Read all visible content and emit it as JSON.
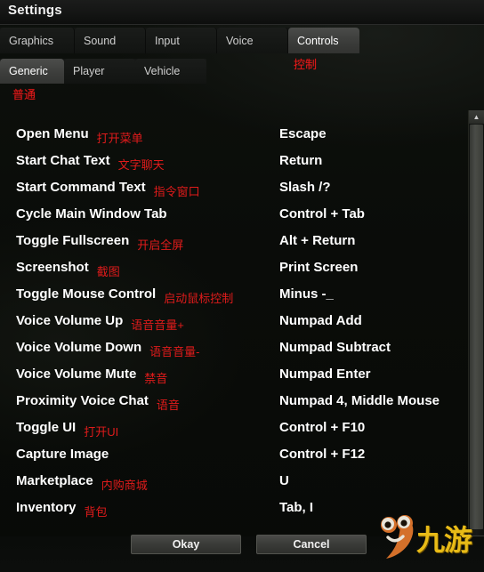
{
  "window": {
    "title": "Settings"
  },
  "tabs": [
    {
      "label": "Graphics",
      "active": false
    },
    {
      "label": "Sound",
      "active": false
    },
    {
      "label": "Input",
      "active": false
    },
    {
      "label": "Voice",
      "active": false
    },
    {
      "label": "Controls",
      "active": true,
      "annotation": "控制"
    }
  ],
  "subtabs": [
    {
      "label": "Generic",
      "active": true,
      "annotation": "普通"
    },
    {
      "label": "Player",
      "active": false
    },
    {
      "label": "Vehicle",
      "active": false
    }
  ],
  "bindings": [
    {
      "action": "Open Menu",
      "annotation": "打开菜单",
      "key": "Escape"
    },
    {
      "action": "Start Chat Text",
      "annotation": "文字聊天",
      "key": "Return"
    },
    {
      "action": "Start Command Text",
      "annotation": "指令窗口",
      "key": "Slash /?"
    },
    {
      "action": "Cycle Main Window Tab",
      "annotation": "",
      "key": "Control + Tab"
    },
    {
      "action": "Toggle Fullscreen",
      "annotation": "开启全屏",
      "key": "Alt + Return"
    },
    {
      "action": "Screenshot",
      "annotation": "截图",
      "key": "Print Screen"
    },
    {
      "action": "Toggle Mouse Control",
      "annotation": "启动鼠标控制",
      "key": "Minus -_"
    },
    {
      "action": "Voice Volume Up",
      "annotation": "语音音量+",
      "key": "Numpad Add"
    },
    {
      "action": "Voice Volume Down",
      "annotation": "语音音量-",
      "key": "Numpad Subtract"
    },
    {
      "action": "Voice Volume Mute",
      "annotation": "禁音",
      "key": "Numpad Enter"
    },
    {
      "action": "Proximity Voice Chat",
      "annotation": "语音",
      "key": "Numpad 4, Middle Mouse"
    },
    {
      "action": "Toggle UI",
      "annotation": "打开UI",
      "key": "Control + F10"
    },
    {
      "action": "Capture Image",
      "annotation": "",
      "key": "Control + F12"
    },
    {
      "action": "Marketplace",
      "annotation": "内购商城",
      "key": "U"
    },
    {
      "action": "Inventory",
      "annotation": "背包",
      "key": "Tab, I"
    }
  ],
  "buttons": {
    "okay": "Okay",
    "cancel": "Cancel"
  },
  "scrollbar": {
    "up": "▲",
    "down": "▼"
  },
  "watermark": {
    "text": "九游"
  },
  "colors": {
    "annotation_red": "#e01b1b",
    "text_white": "#ffffff",
    "active_tab": "#4a4b49",
    "background": "#0b0e0a",
    "watermark_gold": "#e8bb17",
    "watermark_orange": "#d4702a"
  }
}
